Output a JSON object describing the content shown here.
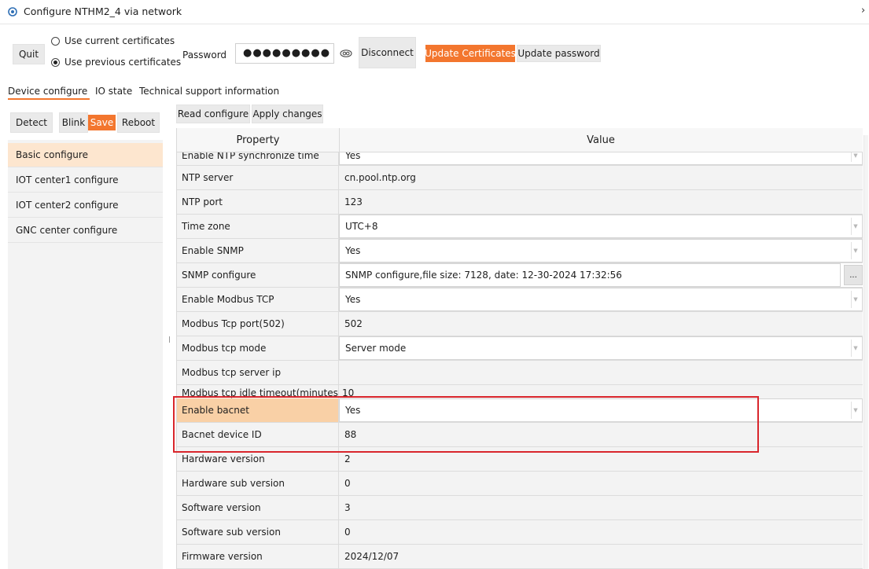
{
  "window": {
    "title": "Configure NTHM2_4 via network",
    "title_chevron": "›"
  },
  "toolbar": {
    "quit_label": "Quit",
    "radio_current": "Use current certificates",
    "radio_previous": "Use previous certificates",
    "password_label": "Password",
    "password_value": "●●●●●●●●●",
    "disconnect_label": "Disconnect",
    "update_certificates_label": "Update Certificates",
    "update_password_label": "Update password"
  },
  "tabs": [
    "Device configure",
    "IO state",
    "Technical support information"
  ],
  "left_toolbar": {
    "detect": "Detect",
    "blink": "Blink",
    "save": "Save",
    "reboot": "Reboot"
  },
  "right_toolbar": {
    "read_configure": "Read configure",
    "apply_changes": "Apply changes"
  },
  "sidebar": {
    "items": [
      {
        "label": "Basic configure"
      },
      {
        "label": "IOT center1 configure"
      },
      {
        "label": "IOT center2 configure"
      },
      {
        "label": "GNC center configure"
      }
    ]
  },
  "grid": {
    "header_property": "Property",
    "header_value": "Value",
    "rows": [
      {
        "property": "Enable NTP synchronize time",
        "value": "Yes"
      },
      {
        "property": "NTP server",
        "value": "cn.pool.ntp.org"
      },
      {
        "property": "NTP port",
        "value": "123"
      },
      {
        "property": "Time zone",
        "value": "UTC+8"
      },
      {
        "property": "Enable SNMP",
        "value": "Yes"
      },
      {
        "property": "SNMP configure",
        "value": "SNMP configure,file size: 7128, date: 12-30-2024 17:32:56",
        "button": "..."
      },
      {
        "property": "Enable Modbus TCP",
        "value": "Yes"
      },
      {
        "property": "Modbus Tcp port(502)",
        "value": "502"
      },
      {
        "property": "Modbus tcp mode",
        "value": "Server mode"
      },
      {
        "property": "Modbus tcp server ip",
        "value": ""
      },
      {
        "property": "Modbus tcp idle timeout(minutes)",
        "value": "10"
      },
      {
        "property": "Enable bacnet",
        "value": "Yes"
      },
      {
        "property": "Bacnet device ID",
        "value": "88"
      },
      {
        "property": "Hardware version",
        "value": "2"
      },
      {
        "property": "Hardware sub version",
        "value": "0"
      },
      {
        "property": "Software version",
        "value": "3"
      },
      {
        "property": "Software sub version",
        "value": "0"
      },
      {
        "property": "Firmware version",
        "value": "2024/12/07"
      }
    ]
  },
  "colors": {
    "accent_orange": "#f3762e",
    "highlight_box": "#d9262c",
    "selected_row": "#f9d0a6"
  }
}
